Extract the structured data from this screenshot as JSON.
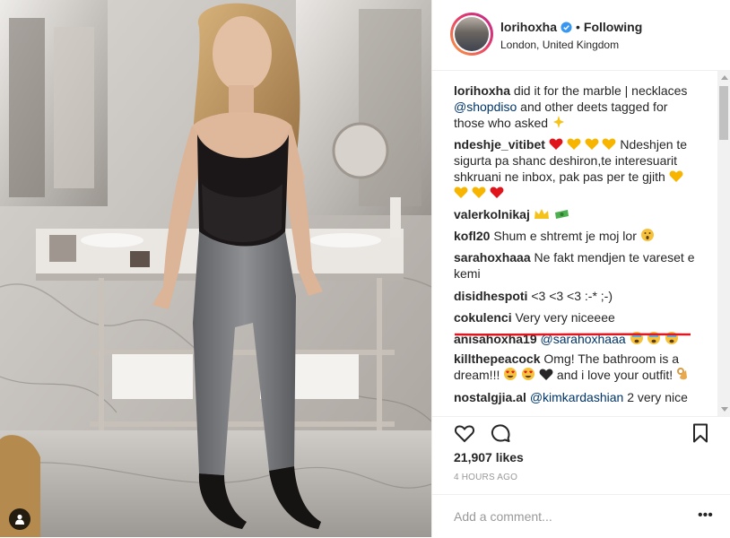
{
  "post": {
    "username": "lorihoxha",
    "separator": "•",
    "follow_status": "Following",
    "location": "London, United Kingdom",
    "likes": "21,907 likes",
    "time": "4 HOURS AGO",
    "add_comment_placeholder": "Add a comment...",
    "more_label": "•••"
  },
  "comments": [
    {
      "user": "lorihoxha",
      "text": "did it for the marble | necklaces",
      "mention": "@shopdiso",
      "text2": "and other deets tagged for those who asked"
    },
    {
      "user": "ndeshje_vitibet",
      "text": "Ndeshjen te sigurta pa shanc deshiron,te interesuarit shkruani ne inbox, pak pas per te gjith"
    },
    {
      "user": "valerkolnikaj",
      "text": ""
    },
    {
      "user": "kofl20",
      "text": "Shum e shtremt je moj lor"
    },
    {
      "user": "sarahoxhaaa",
      "text": "Ne fakt mendjen te vareset e kemi"
    },
    {
      "user": "disidhespoti",
      "text": "<3 <3 <3 :-* ;-)"
    },
    {
      "user": "cokulenci",
      "text": "Very very niceeee"
    },
    {
      "user": "anisahoxha19",
      "mention": "@sarahoxhaaa"
    },
    {
      "user": "killthepeacock",
      "text": "Omg! The bathroom is a dream!!!",
      "text2": "and i love your outfit!"
    },
    {
      "user": "nostalgjia.al",
      "mention": "@kimkardashian",
      "text": "2 very nice"
    }
  ],
  "colors": {
    "text": "#262626",
    "mention": "#003569",
    "verified": "#3897f0",
    "muted": "#999999",
    "annotation": "#e3151f"
  },
  "icons": [
    "user-tag-icon",
    "verified-icon",
    "heart-icon",
    "comment-icon",
    "bookmark-icon",
    "more-icon"
  ]
}
